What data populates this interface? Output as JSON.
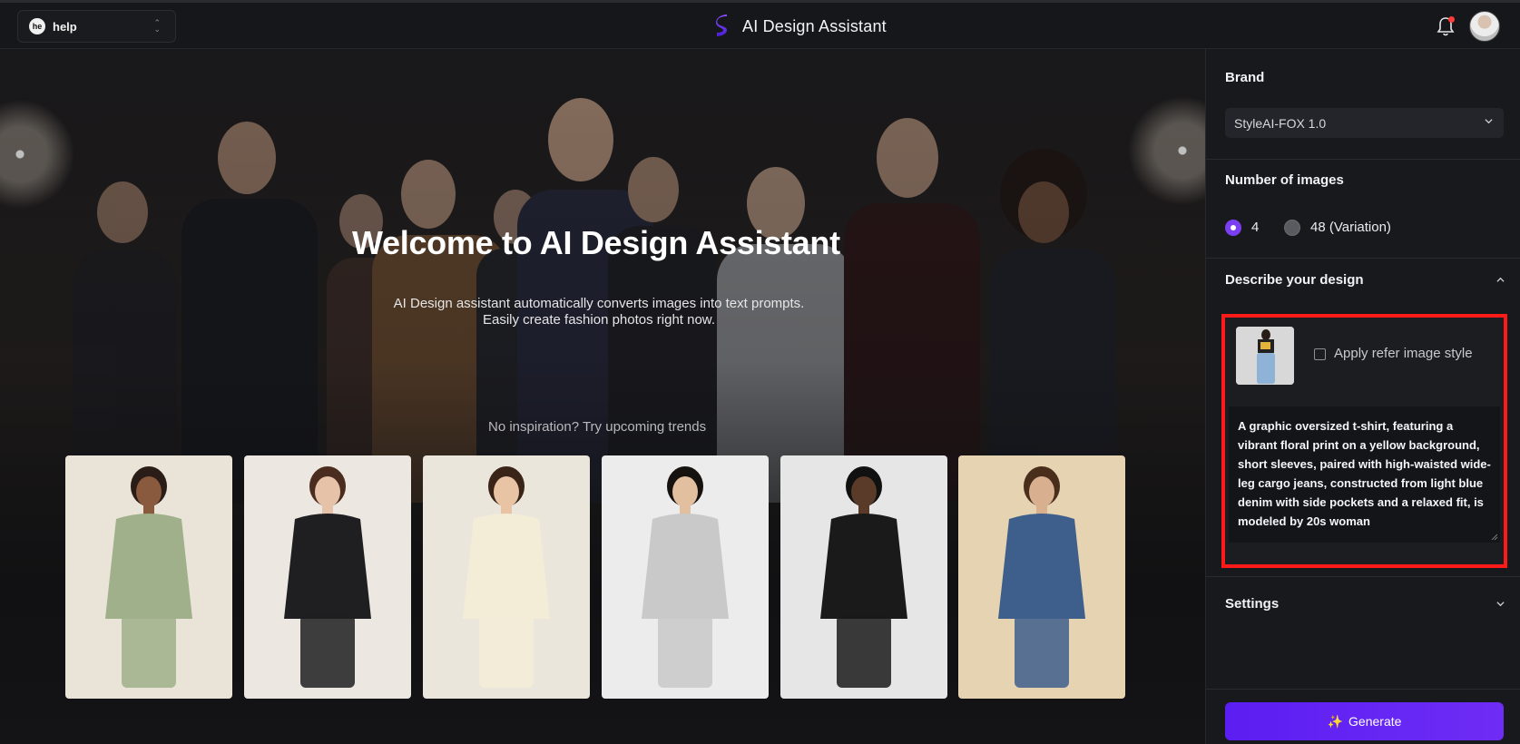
{
  "header": {
    "workspace_badge": "he",
    "workspace_name": "help",
    "app_title": "AI Design Assistant"
  },
  "hero": {
    "title": "Welcome to AI Design Assistant",
    "subtitle": "AI Design assistant automatically converts images into text prompts. Easily create fashion photos right now.",
    "trend_label": "No inspiration? Try upcoming trends"
  },
  "trends": [
    {
      "name": "floral-maxi-wrap-dress",
      "bg": "#e9e3d8",
      "outfit": "#9fb08a",
      "skin": "#8a5a3e",
      "hair": "#2a1d17"
    },
    {
      "name": "black-leather-jacket",
      "bg": "#ece7e0",
      "outfit": "#1f1f21",
      "skin": "#e5c2a8",
      "hair": "#4b2d1f"
    },
    {
      "name": "cream-knit-polo-sweater",
      "bg": "#ebe6dc",
      "outfit": "#f3ecd7",
      "skin": "#e8c3a4",
      "hair": "#3a2418"
    },
    {
      "name": "striped-shirt-black-tie",
      "bg": "#ececec",
      "outfit": "#c9c9c9",
      "skin": "#e2bf9f",
      "hair": "#15120f"
    },
    {
      "name": "black-white-floral-shirt",
      "bg": "#e6e6e6",
      "outfit": "#1a1a1a",
      "skin": "#5a3a28",
      "hair": "#111"
    },
    {
      "name": "denim-jacket-striped-tee",
      "bg": "#e6d3b1",
      "outfit": "#3e5e8c",
      "skin": "#d9b08f",
      "hair": "#4a2e1c"
    }
  ],
  "panel": {
    "brand_label": "Brand",
    "brand_value": "StyleAI-FOX 1.0",
    "images_label": "Number of images",
    "option_four": "4",
    "option_variation": "48 (Variation)",
    "describe_label": "Describe your design",
    "apply_style_label": "Apply refer image style",
    "prompt_text": "A graphic oversized t-shirt, featuring a vibrant floral print on a yellow background, short sleeves, paired with high-waisted wide-leg cargo jeans, constructed from light blue denim with side pockets and a relaxed fit, is modeled by 20s woman",
    "settings_label": "Settings",
    "generate_label": "Generate",
    "generate_icon": "✨"
  },
  "colors": {
    "accent": "#6e2cf5",
    "highlight_border": "#ff1a1a",
    "notification": "#ff3b3b"
  }
}
